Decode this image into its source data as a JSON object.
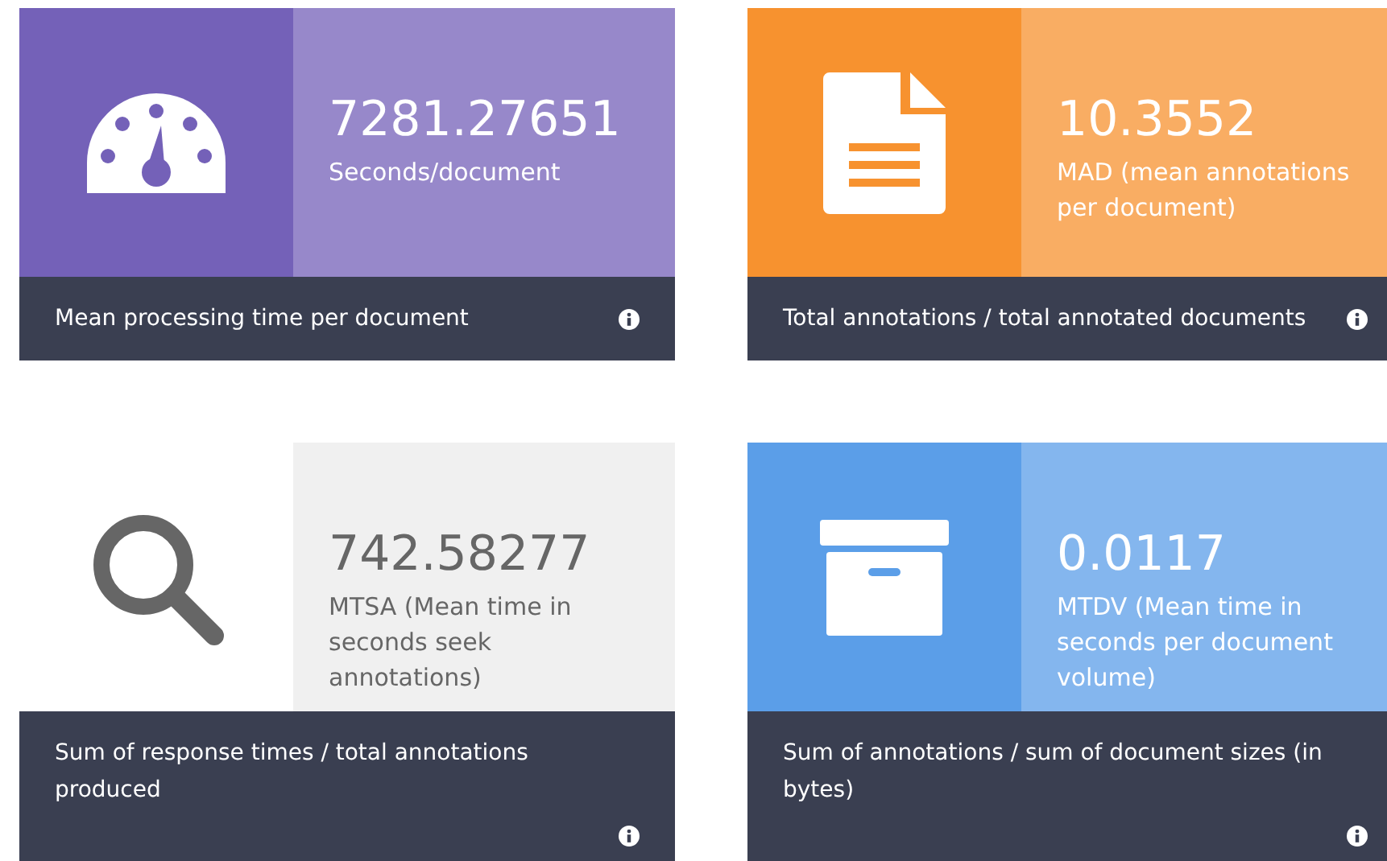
{
  "cards": [
    {
      "kind": "gauge",
      "color": "#7461b8",
      "value": "7281.27651",
      "label": "Seconds/document",
      "footer": "Mean processing time per document"
    },
    {
      "kind": "document",
      "color": "#f7922f",
      "value": "10.3552",
      "label": "MAD (mean annotations per document)",
      "footer": "Total annotations / total annotated documents"
    },
    {
      "kind": "search",
      "color": "#f0f0f0",
      "value": "742.58277",
      "label": "MTSA (Mean time in seconds seek annotations)",
      "footer": "Sum of response times / total annotations produced"
    },
    {
      "kind": "archive",
      "color": "#5b9ee8",
      "value": "0.0117",
      "label": "MTDV (Mean time in seconds per document volume)",
      "footer": "Sum of annotations / sum of document sizes (in bytes)"
    }
  ]
}
